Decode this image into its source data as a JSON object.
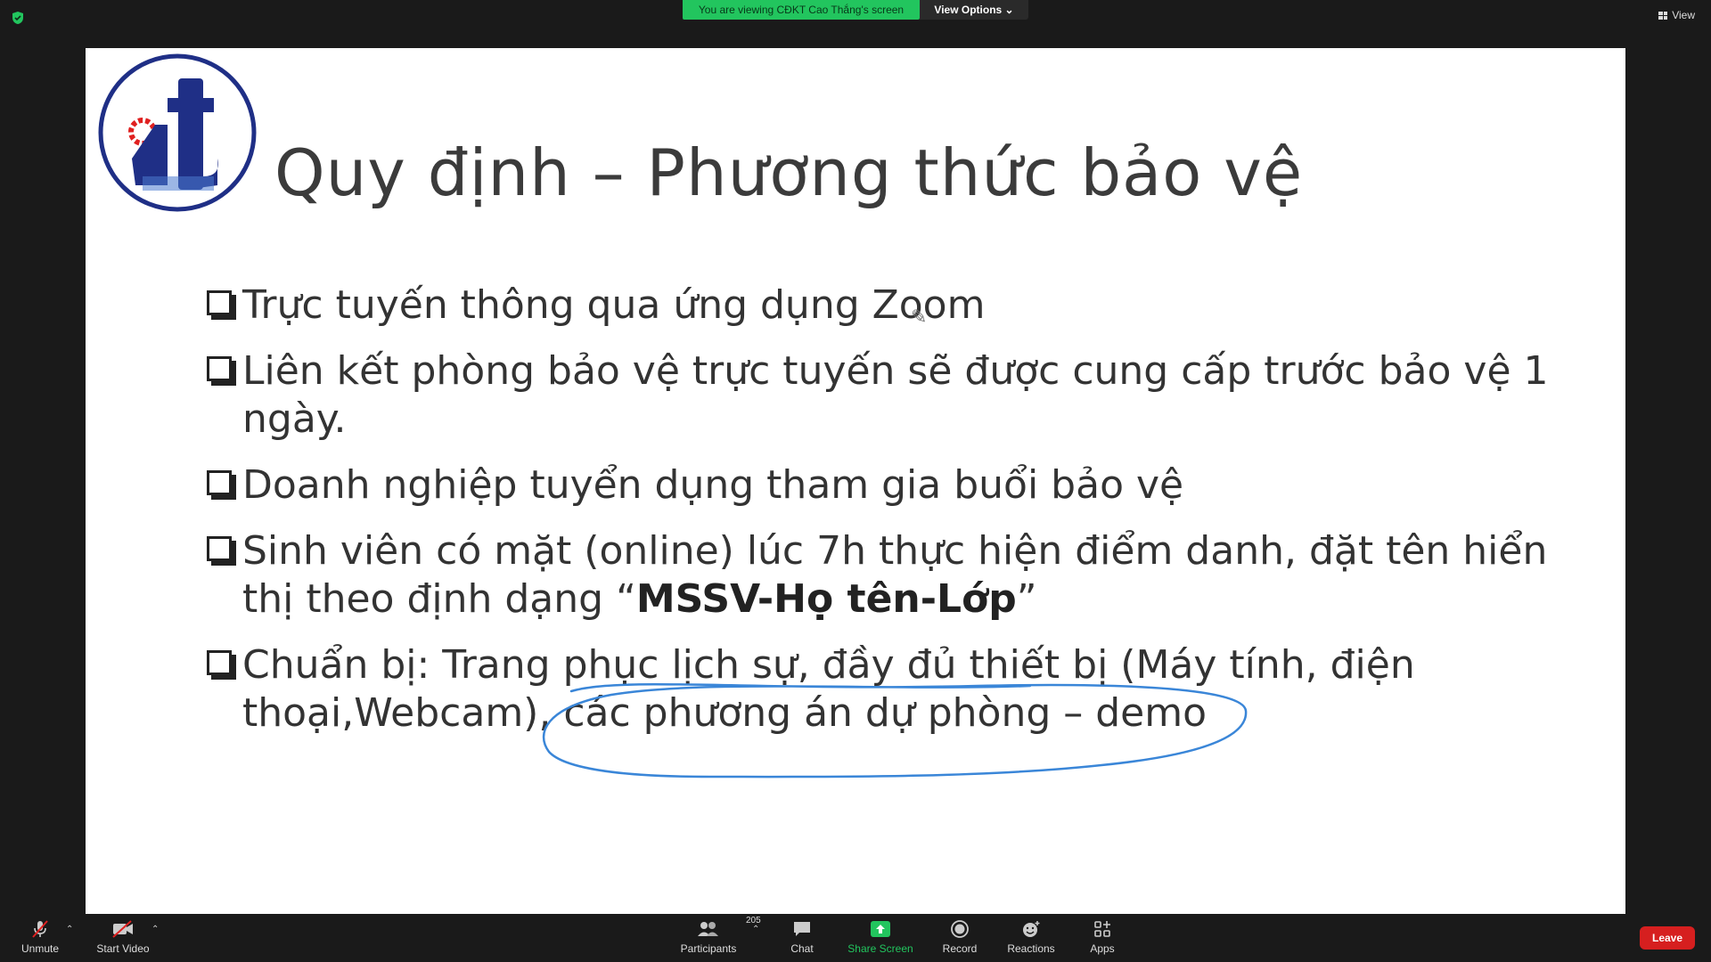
{
  "banner": {
    "viewing_text": "You are viewing CĐKT Cao Thắng's screen",
    "view_options_label": "View Options ⌄"
  },
  "top_right": {
    "view_label": "View"
  },
  "slide": {
    "title": "Quy định – Phương thức bảo vệ",
    "bullets": [
      {
        "text": "Trực tuyến thông qua ứng dụng Zoom"
      },
      {
        "text": "Liên kết phòng bảo vệ trực tuyến sẽ được cung cấp trước bảo vệ 1 ngày."
      },
      {
        "text": "Doanh nghiệp tuyển dụng tham gia buổi bảo vệ"
      },
      {
        "text_before": "Sinh viên có mặt (online) lúc 7h thực hiện điểm danh, đặt tên hiển thị theo định dạng “",
        "bold": "MSSV-Họ tên-Lớp",
        "text_after": "”"
      },
      {
        "text_before": "Chuẩn bị: Trang phục lịch sự, đầy đủ thiết bị (Máy tính, điện thoại,Webcam), ",
        "text_circled": "các phương án dự phòng – demo"
      }
    ],
    "annotation_color": "#3a86d8"
  },
  "toolbar": {
    "unmute": "Unmute",
    "start_video": "Start Video",
    "participants": "Participants",
    "participants_count": "205",
    "chat": "Chat",
    "share_screen": "Share Screen",
    "record": "Record",
    "reactions": "Reactions",
    "apps": "Apps",
    "leave": "Leave"
  },
  "colors": {
    "banner_green": "#22c55e",
    "leave_red": "#d61f1f",
    "logo_blue": "#1f2f86",
    "logo_red": "#e02020"
  }
}
